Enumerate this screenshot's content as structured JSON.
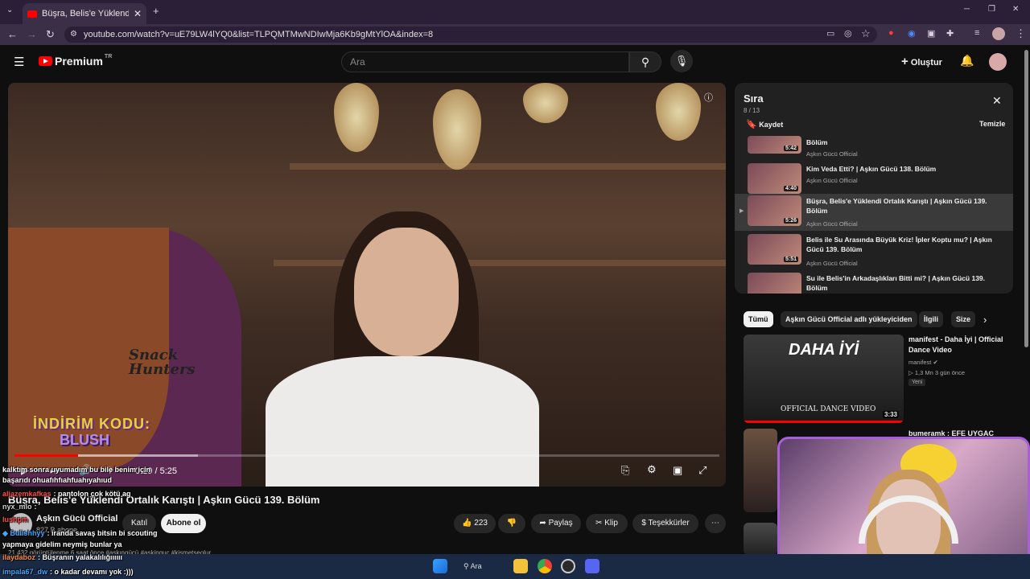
{
  "browser": {
    "tab_title": "Büşra, Belis'e Yüklendi Ortalık K",
    "tab_close": "✕",
    "new_tab": "+",
    "url": "youtube.com/watch?v=uE79LW4lYQ0&list=TLPQMTMwNDIwMja6Kb9gMtYlOA&index=8",
    "window_controls": [
      "─",
      "❐",
      "✕"
    ]
  },
  "yt_header": {
    "logo_text": "Premium",
    "logo_region": "TR",
    "search_placeholder": "Ara",
    "create_label": "Oluştur"
  },
  "video": {
    "promo_line1": "İNDİRİM KODU:",
    "promo_line2": "BLUSH",
    "shirt_text": "Snack Hunters",
    "current_time": "0:29",
    "duration": "5:25",
    "time_display": "0:29 / 5:25",
    "progress_fraction": 0.09,
    "buffer_fraction": 0.26,
    "title": "Büşra, Belis'e Yüklendi Ortalık Karıştı | Aşkın Gücü 139. Bölüm",
    "channel": "Aşkın Gücü Official",
    "subscribers": "827 B abone",
    "join_label": "Katıl",
    "subscribe_label": "Abone ol",
    "likes": "223",
    "share_label": "Paylaş",
    "clip_label": "Klip",
    "thanks_label": "Teşekkürler",
    "description_line": "21.432 görüntülenme  6 saat önce  #aşkıngücü #askinguc #kismetseolur"
  },
  "queue": {
    "title": "Sıra",
    "count": "8 / 13",
    "save_label": "Kaydet",
    "clear_label": "Temizle",
    "items": [
      {
        "title": "Bölüm",
        "channel": "Aşkın Gücü Official",
        "duration": "5:42",
        "active": false
      },
      {
        "title": "Kim Veda Etti? | Aşkın Gücü 138. Bölüm",
        "channel": "Aşkın Gücü Official",
        "duration": "4:40",
        "active": false
      },
      {
        "title": "Büşra, Belis'e Yüklendi Ortalık Karıştı | Aşkın Gücü 139. Bölüm",
        "channel": "Aşkın Gücü Official",
        "duration": "5:26",
        "active": true
      },
      {
        "title": "Belis ile Su Arasında Büyük Kriz! İpler Koptu mu? | Aşkın Gücü 139. Bölüm",
        "channel": "Aşkın Gücü Official",
        "duration": "5:51",
        "active": false
      },
      {
        "title": "Su ile Belis'in Arkadaşlıkları Bitti mi? | Aşkın Gücü 139. Bölüm",
        "channel": "",
        "duration": "",
        "active": false
      }
    ]
  },
  "chips": [
    "Tümü",
    "Aşkın Gücü Official adlı yükleyiciden",
    "İlgili",
    "Size"
  ],
  "recommendations": [
    {
      "title": "manifest - Daha İyi | Official Dance Video",
      "channel": "manifest",
      "meta": "1,3 Mn  3 gün önce",
      "badge": "Yeni",
      "duration": "3:33",
      "thumb_text": "DAHA İYİ",
      "thumb_sub": "OFFICIAL DANCE VIDEO"
    },
    {
      "title": "bumeramk : EFE UYGAC",
      "channel": "",
      "meta": "",
      "badge": "",
      "duration": "",
      "thumb_text": "",
      "thumb_sub": ""
    }
  ],
  "chat": [
    {
      "user": "",
      "text": "kalktım sonra uyumadım bu bile benim için",
      "color": "#ffffff"
    },
    {
      "user": "",
      "text": "başarıdı ohuafıhfıahfuahıyahıud",
      "color": "#ffffff"
    },
    {
      "user": "aljazemkafkas",
      "text": "pantolon çok kötü ag",
      "color": "#ff4a4a"
    },
    {
      "user": "nyx_mlo",
      "text": "",
      "color": "#cfcfcf"
    },
    {
      "user": "lushpm",
      "text": "",
      "color": "#ff4a4a"
    },
    {
      "user": "Bulishhyy",
      "text": "iranda savaş bitsin bi scouting",
      "color": "#3fa8ff"
    },
    {
      "user": "",
      "text": "yapmaya gidelim neymiş bunlar ya",
      "color": "#ffffff"
    },
    {
      "user": "ilaydaboz",
      "text": "Büşranın yalakalılığıııııı",
      "color": "#ff8c3a"
    },
    {
      "user": "impala67_dw",
      "text": "o kadar devamı yok :)))",
      "color": "#3fa8ff"
    }
  ],
  "taskbar": {
    "search_label": "Ara"
  },
  "colors": {
    "accent_red": "#ff0000",
    "webcam_border": "#a95fd6",
    "browser_frame": "#2a1f36"
  }
}
